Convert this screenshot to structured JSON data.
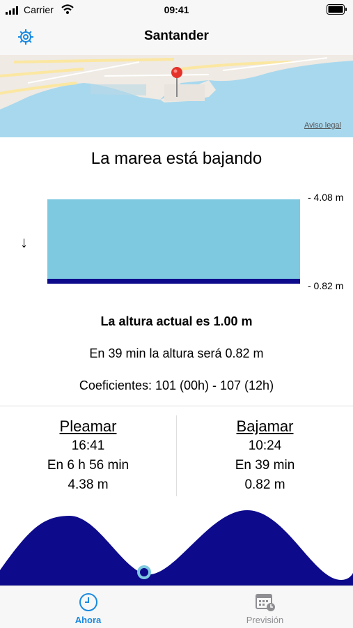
{
  "status_bar": {
    "carrier": "Carrier",
    "time": "09:41"
  },
  "nav": {
    "title": "Santander",
    "settings_icon": "gear-icon"
  },
  "map": {
    "legal_link": "Aviso legal",
    "pin_icon": "map-pin-icon"
  },
  "tide": {
    "heading": "La marea está bajando",
    "direction_icon": "down-arrow-icon",
    "max_label": "- 4.08 m",
    "min_label": "- 0.82 m",
    "level_fraction": 0.055,
    "current_height": "La altura actual es 1.00 m",
    "next_height": "En 39 min la altura será 0.82 m",
    "coefficients": "Coeficientes: 101 (00h) - 107 (12h)",
    "water_color": "#7ec9e0",
    "level_color": "#0d0a8c"
  },
  "pleamar": {
    "title": "Pleamar",
    "time": "16:41",
    "remaining": "En 6 h 56 min",
    "height": "4.38 m"
  },
  "bajamar": {
    "title": "Bajamar",
    "time": "10:24",
    "remaining": "En 39 min",
    "height": "0.82 m"
  },
  "tabs": [
    {
      "label": "Ahora",
      "icon": "clock-icon",
      "active": true
    },
    {
      "label": "Previsión",
      "icon": "calendar-icon",
      "active": false
    }
  ],
  "colors": {
    "accent": "#1a8ae0",
    "inactive": "#8e8e93",
    "wave": "#0d0a8c"
  }
}
